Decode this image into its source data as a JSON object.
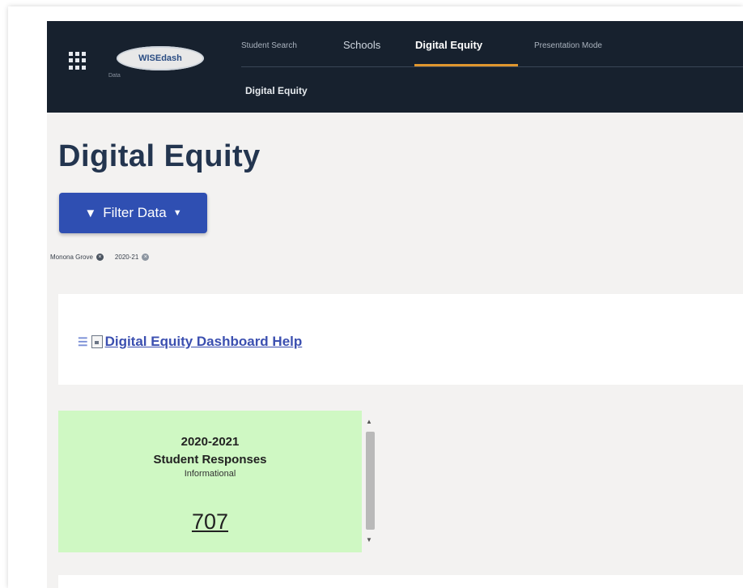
{
  "nav": {
    "logo_text": "WISEdash",
    "logo_sub": "Data",
    "tabs": [
      {
        "label": "Student Search"
      },
      {
        "label": "Schools"
      },
      {
        "label": "Digital Equity"
      },
      {
        "label": "Presentation Mode"
      }
    ],
    "subnav_label": "Digital Equity",
    "accent_color": "#e0962e"
  },
  "page": {
    "title": "Digital Equity",
    "filter_button_label": "Filter Data",
    "filters": [
      {
        "label": "Monona Grove"
      },
      {
        "label": "2020-21"
      }
    ]
  },
  "help": {
    "link_text": "Digital Equity Dashboard Help"
  },
  "card": {
    "year": "2020-2021",
    "title": "Student Responses",
    "subtitle": "Informational",
    "value": "707",
    "color": "#cff8c3"
  }
}
